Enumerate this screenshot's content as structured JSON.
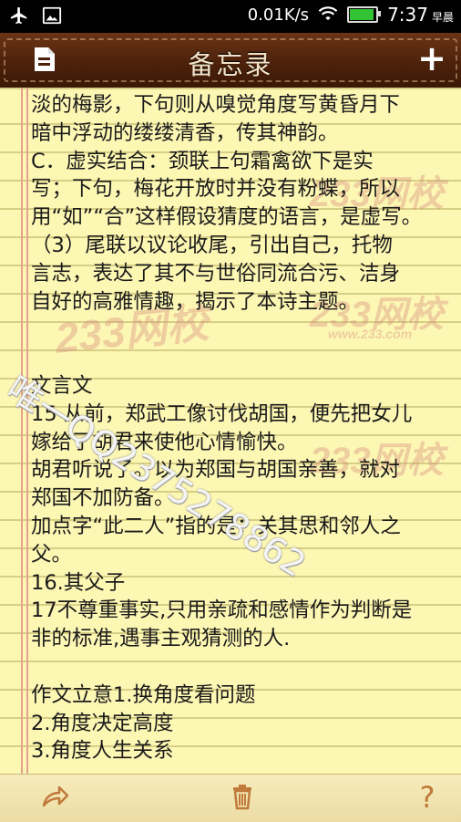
{
  "status_bar": {
    "speed": "0.01K/s",
    "time": "7:37",
    "ampm": "早晨",
    "icons": [
      "airplane-icon",
      "image-icon",
      "wifi-icon",
      "battery-icon"
    ]
  },
  "header": {
    "title": "备忘录",
    "left_icon": "note-list-icon",
    "right_icon": "plus-icon",
    "add_label": "+"
  },
  "note": {
    "lines": [
      "淡的梅影，下句则从嗅觉角度写黄昏月下",
      "暗中浮动的缕缕清香，传其神韵。",
      " C．虚实结合：颈联上句霜禽欲下是实",
      "写；下句，梅花开放时并没有粉蝶，所以",
      "用“如”“合”这样假设猜度的语言，是虚写。",
      "（3）尾联以议论收尾，引出自己，托物",
      "言志，表达了其不与世俗同流合污、洁身",
      "自好的高雅情趣，揭示了本诗主题。",
      "",
      "",
      " 文言文",
      "15 从前，郑武工像讨伐胡国，便先把女儿",
      "嫁给了胡君来使他心情愉快。",
      " 胡君听说了。以为郑国与胡国亲善，就对",
      "郑国不加防备。",
      " 加点字“此二人”指的是：关其思和邻人之",
      "父。",
      "16.其父子",
      "17不尊重事实,只用亲疏和感情作为判断是",
      "非的标准,遇事主观猜测的人.",
      "",
      "作文立意1.换角度看问题",
      "2.角度决定高度",
      "3.角度人生关系"
    ],
    "watermarks": {
      "brand": "233网校",
      "brand_url": "www.233.com",
      "overlay": "唯一QQ2375278862"
    }
  },
  "toolbar": {
    "icons": [
      "share-icon",
      "trash-icon",
      "help-icon"
    ],
    "help_label": "?"
  },
  "colors": {
    "paper": "#fdf7b4",
    "rule": "#d8cf86",
    "margin_rule": "#e6a08e",
    "header": "#4d220b",
    "toolbar_icon": "#c07a3a"
  }
}
